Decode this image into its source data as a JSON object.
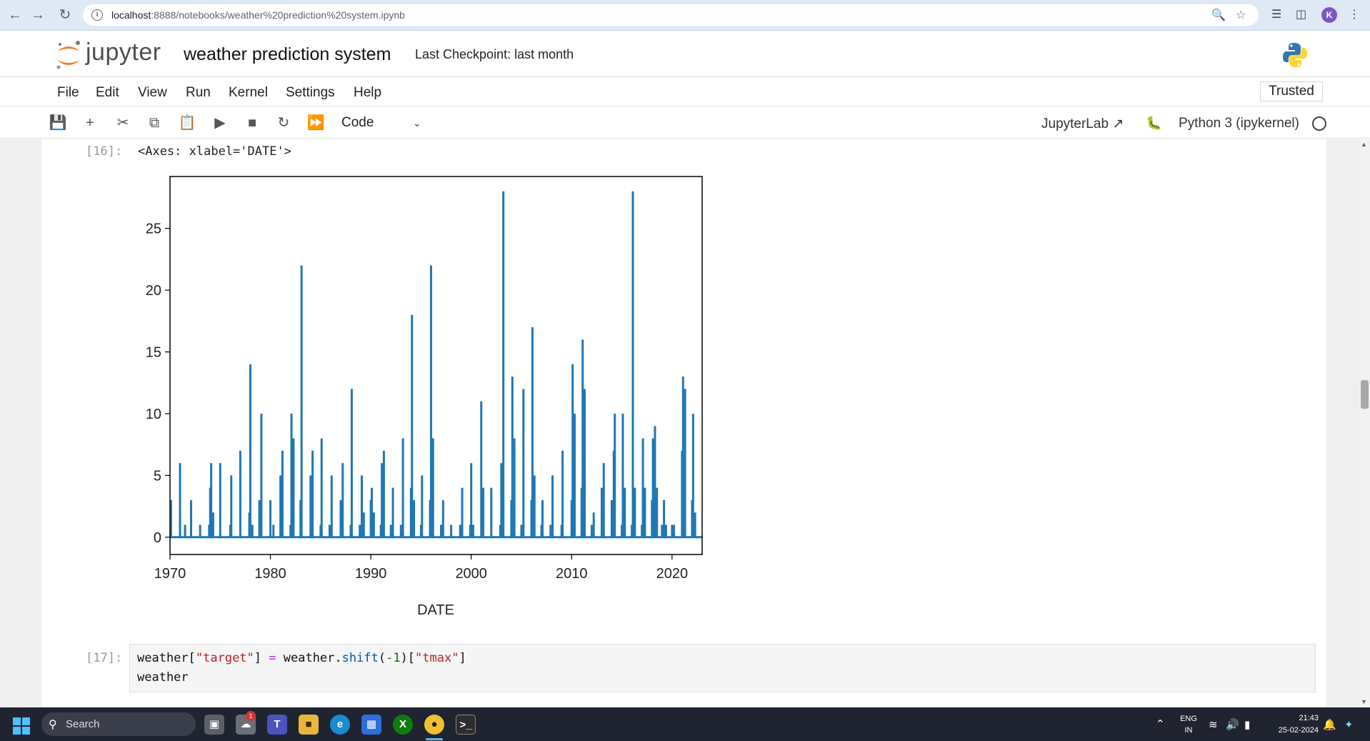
{
  "browser": {
    "url_host": "localhost",
    "url_path": ":8888/notebooks/weather%20prediction%20system.ipynb",
    "profile_initial": "K"
  },
  "header": {
    "logo_text": "jupyter",
    "notebook_title": "weather prediction system",
    "checkpoint": "Last Checkpoint: last month"
  },
  "menu": {
    "items": [
      "File",
      "Edit",
      "View",
      "Run",
      "Kernel",
      "Settings",
      "Help"
    ],
    "trusted": "Trusted"
  },
  "toolbar": {
    "cell_type": "Code",
    "jupyterlab": "JupyterLab",
    "kernel": "Python 3 (ipykernel)"
  },
  "output_cell": {
    "prompt": "[16]:",
    "text": "<Axes: xlabel='DATE'>"
  },
  "chart_data": {
    "type": "line",
    "xlabel": "DATE",
    "ylabel": "",
    "xlim": [
      1970,
      2023
    ],
    "ylim": [
      -1.4,
      29.2
    ],
    "xticks": [
      1970,
      1980,
      1990,
      2000,
      2010,
      2020
    ],
    "yticks": [
      0,
      5,
      10,
      15,
      20,
      25
    ],
    "series": [
      {
        "color": "#1f77b4",
        "spikes": [
          [
            1970.1,
            3
          ],
          [
            1971.0,
            6
          ],
          [
            1971.5,
            1
          ],
          [
            1972.1,
            3
          ],
          [
            1973.0,
            1
          ],
          [
            1973.9,
            1
          ],
          [
            1974.0,
            4
          ],
          [
            1974.1,
            6
          ],
          [
            1974.3,
            2
          ],
          [
            1975.0,
            6
          ],
          [
            1976.0,
            1
          ],
          [
            1976.1,
            5
          ],
          [
            1977.0,
            7
          ],
          [
            1977.9,
            2
          ],
          [
            1978.0,
            14
          ],
          [
            1978.2,
            1
          ],
          [
            1978.9,
            3
          ],
          [
            1979.1,
            10
          ],
          [
            1980.0,
            3
          ],
          [
            1980.3,
            1
          ],
          [
            1981.0,
            5
          ],
          [
            1981.2,
            7
          ],
          [
            1982.0,
            1
          ],
          [
            1982.1,
            10
          ],
          [
            1982.3,
            8
          ],
          [
            1983.0,
            3
          ],
          [
            1983.1,
            22
          ],
          [
            1984.0,
            5
          ],
          [
            1984.2,
            7
          ],
          [
            1985.0,
            1
          ],
          [
            1985.1,
            8
          ],
          [
            1985.9,
            1
          ],
          [
            1986.1,
            5
          ],
          [
            1987.0,
            3
          ],
          [
            1987.2,
            6
          ],
          [
            1988.0,
            1
          ],
          [
            1988.1,
            12
          ],
          [
            1988.9,
            1
          ],
          [
            1989.1,
            5
          ],
          [
            1989.3,
            2
          ],
          [
            1990.0,
            3
          ],
          [
            1990.1,
            4
          ],
          [
            1990.3,
            2
          ],
          [
            1991.0,
            1
          ],
          [
            1991.1,
            6
          ],
          [
            1991.3,
            7
          ],
          [
            1992.0,
            1
          ],
          [
            1992.2,
            4
          ],
          [
            1993.0,
            1
          ],
          [
            1993.2,
            8
          ],
          [
            1994.0,
            4
          ],
          [
            1994.1,
            18
          ],
          [
            1994.3,
            3
          ],
          [
            1995.0,
            1
          ],
          [
            1995.1,
            5
          ],
          [
            1995.9,
            3
          ],
          [
            1996.0,
            22
          ],
          [
            1996.2,
            8
          ],
          [
            1997.0,
            1
          ],
          [
            1997.2,
            3
          ],
          [
            1998.0,
            1
          ],
          [
            1998.9,
            1
          ],
          [
            1999.1,
            4
          ],
          [
            1999.9,
            1
          ],
          [
            2000.0,
            6
          ],
          [
            2000.2,
            1
          ],
          [
            2001.0,
            11
          ],
          [
            2001.2,
            4
          ],
          [
            2002.0,
            4
          ],
          [
            2002.9,
            1
          ],
          [
            2003.0,
            6
          ],
          [
            2003.2,
            28
          ],
          [
            2004.0,
            3
          ],
          [
            2004.1,
            13
          ],
          [
            2004.3,
            8
          ],
          [
            2005.0,
            1
          ],
          [
            2005.2,
            12
          ],
          [
            2006.0,
            3
          ],
          [
            2006.1,
            17
          ],
          [
            2006.3,
            5
          ],
          [
            2007.0,
            1
          ],
          [
            2007.1,
            3
          ],
          [
            2007.9,
            1
          ],
          [
            2008.1,
            5
          ],
          [
            2009.0,
            1
          ],
          [
            2009.1,
            7
          ],
          [
            2010.0,
            3
          ],
          [
            2010.1,
            14
          ],
          [
            2010.3,
            10
          ],
          [
            2011.0,
            4
          ],
          [
            2011.1,
            16
          ],
          [
            2011.3,
            12
          ],
          [
            2012.0,
            1
          ],
          [
            2012.2,
            2
          ],
          [
            2013.0,
            4
          ],
          [
            2013.2,
            6
          ],
          [
            2014.0,
            3
          ],
          [
            2014.2,
            7
          ],
          [
            2014.3,
            10
          ],
          [
            2015.0,
            1
          ],
          [
            2015.1,
            10
          ],
          [
            2015.3,
            4
          ],
          [
            2016.0,
            1
          ],
          [
            2016.1,
            28
          ],
          [
            2016.3,
            4
          ],
          [
            2017.0,
            1
          ],
          [
            2017.1,
            8
          ],
          [
            2017.3,
            4
          ],
          [
            2018.0,
            3
          ],
          [
            2018.1,
            8
          ],
          [
            2018.3,
            9
          ],
          [
            2018.5,
            4
          ],
          [
            2019.0,
            1
          ],
          [
            2019.2,
            3
          ],
          [
            2019.4,
            1
          ],
          [
            2020.0,
            1
          ],
          [
            2020.2,
            1
          ],
          [
            2021.0,
            7
          ],
          [
            2021.1,
            13
          ],
          [
            2021.3,
            12
          ],
          [
            2022.0,
            3
          ],
          [
            2022.1,
            10
          ],
          [
            2022.3,
            2
          ]
        ]
      }
    ]
  },
  "input_cell": {
    "prompt": "[17]:",
    "line1": {
      "t1": "weather[",
      "t2": "\"target\"",
      "t3": "] ",
      "t4": "=",
      "t5": " weather.",
      "t6": "shift",
      "t7": "(",
      "t8": "-1",
      "t9": ")[",
      "t10": "\"tmax\"",
      "t11": "]"
    },
    "line2": "weather"
  },
  "taskbar": {
    "search_label": "Search",
    "lang1": "ENG",
    "lang2": "IN",
    "time": "21:43",
    "date": "25-02-2024",
    "badge": "1"
  }
}
